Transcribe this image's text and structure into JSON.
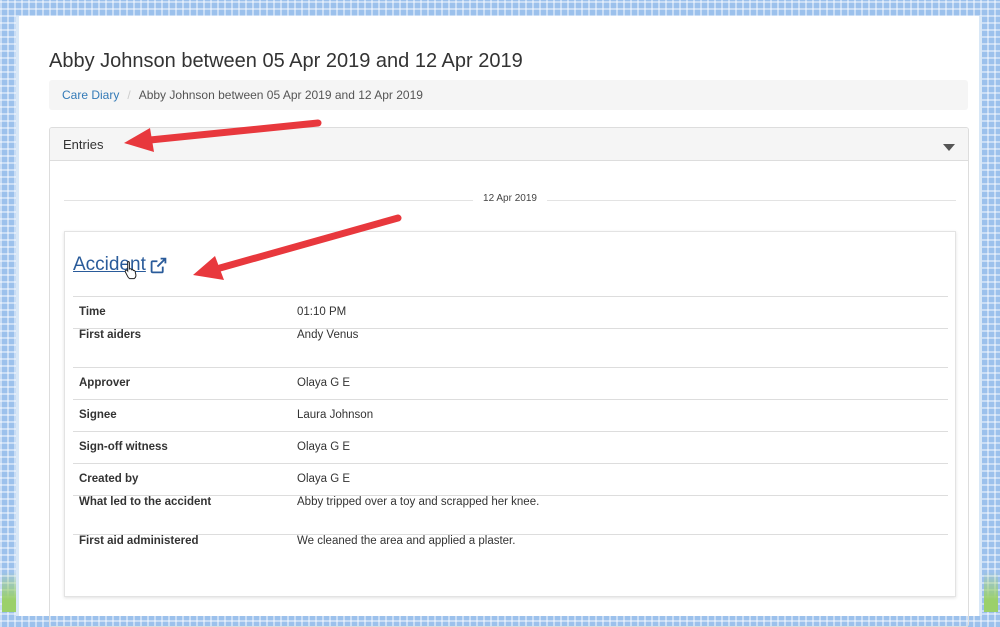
{
  "page": {
    "title": "Abby Johnson between 05 Apr 2019 and 12 Apr 2019"
  },
  "breadcrumb": {
    "home": "Care Diary",
    "current": "Abby Johnson between 05 Apr 2019 and 12 Apr 2019"
  },
  "panel": {
    "heading": "Entries"
  },
  "entries": [
    {
      "date": "12 Apr 2019",
      "type": "Accident",
      "fields": [
        {
          "label": "Time",
          "value": "01:10 PM"
        },
        {
          "label": "First aiders",
          "value": "Andy Venus"
        },
        {
          "label": "Approver",
          "value": "Olaya G E"
        },
        {
          "label": "Signee",
          "value": "Laura Johnson"
        },
        {
          "label": "Sign-off witness",
          "value": "Olaya G E"
        },
        {
          "label": "Created by",
          "value": "Olaya G E"
        },
        {
          "label": "What led to the accident",
          "value": "Abby tripped over a toy and scrapped her knee."
        },
        {
          "label": "First aid administered",
          "value": "We cleaned the area and applied a plaster."
        }
      ]
    }
  ],
  "colors": {
    "annotation_arrow": "#e8383d",
    "link": "#337ab7",
    "background_pattern": "#9cc1ec"
  },
  "icons": [
    "external-link-icon",
    "caret-down-icon",
    "pointer-cursor-icon"
  ]
}
